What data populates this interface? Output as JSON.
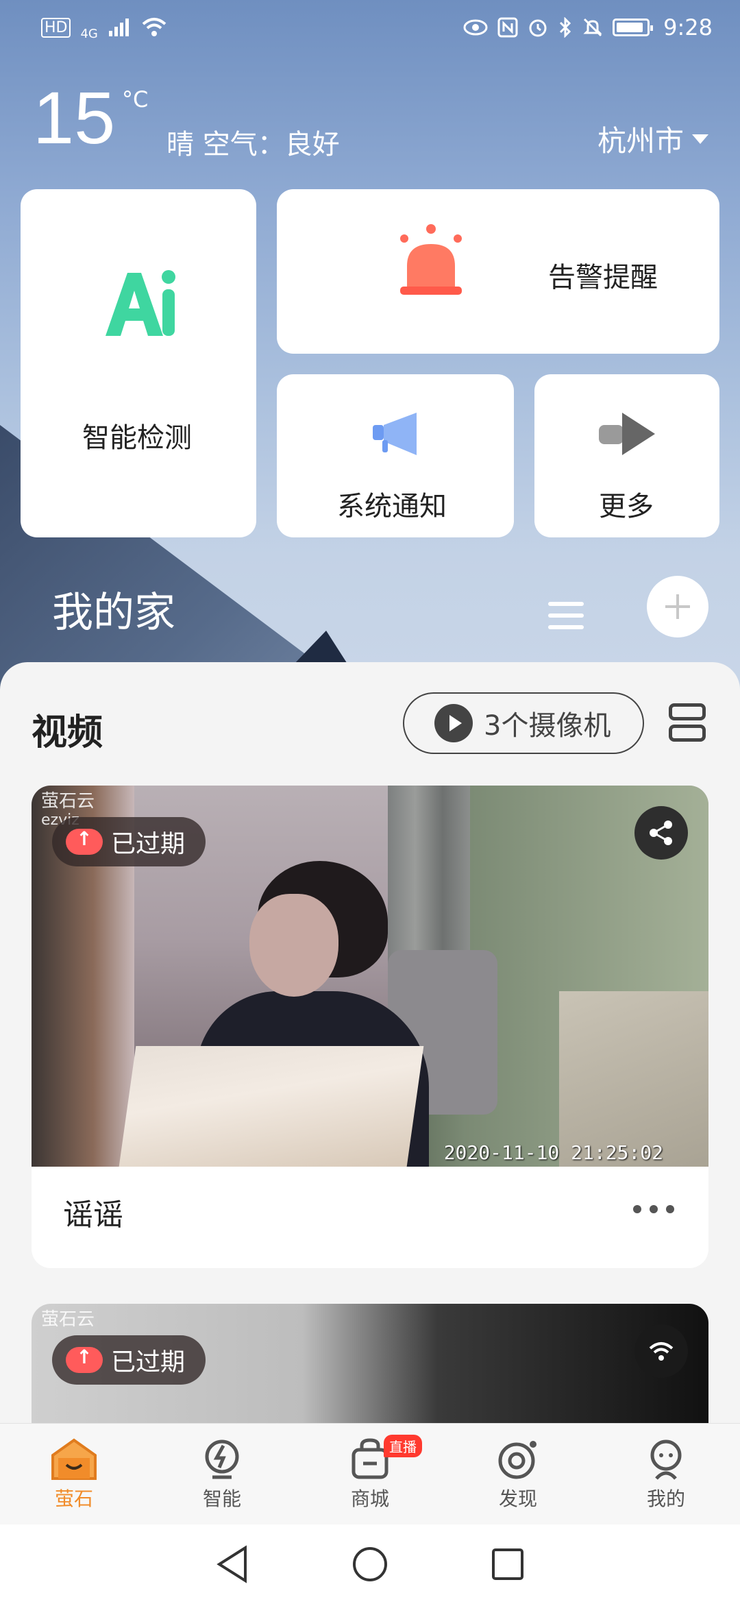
{
  "status_bar": {
    "hd": "HD",
    "network": "4G",
    "time": "9:28"
  },
  "weather": {
    "temperature": "15",
    "unit": "°C",
    "description": "晴 空气：良好",
    "city": "杭州市"
  },
  "shortcuts": {
    "ai_label": "智能检测",
    "ai_icon_text": "Ai",
    "alarm_label": "告警提醒",
    "notice_label": "系统通知",
    "more_label": "更多"
  },
  "home": {
    "title": "我的家"
  },
  "video_section": {
    "title": "视频",
    "camera_count_label": "3个摄像机"
  },
  "cameras": [
    {
      "name": "谣谣",
      "status": "已过期",
      "timestamp": "2020-11-10 21:25:02",
      "brand": "萤石云",
      "brand_en": "ezviz"
    },
    {
      "status": "已过期",
      "brand": "萤石云"
    }
  ],
  "tabbar": {
    "items": [
      {
        "label": "萤石",
        "icon": "home-icon",
        "active": true
      },
      {
        "label": "智能",
        "icon": "smart-icon",
        "active": false
      },
      {
        "label": "商城",
        "icon": "shop-icon",
        "active": false,
        "badge": "直播"
      },
      {
        "label": "发现",
        "icon": "discover-icon",
        "active": false
      },
      {
        "label": "我的",
        "icon": "profile-icon",
        "active": false
      }
    ]
  },
  "colors": {
    "accent": "#f18c2a",
    "ai_green": "#3fd6a0",
    "alarm_red": "#ff6b5a",
    "notice_blue": "#6d9bf2",
    "expired_red": "#ff5b5b"
  }
}
